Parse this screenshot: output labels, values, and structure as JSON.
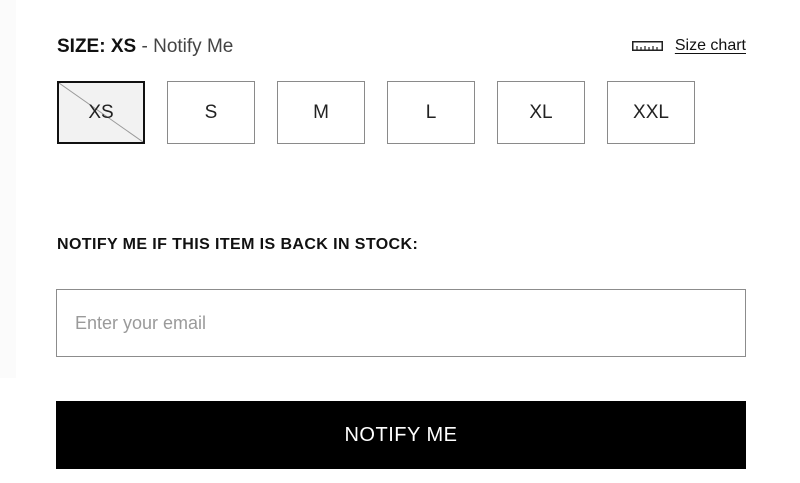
{
  "size_selector": {
    "label": "SIZE:",
    "selected_value": "XS",
    "separator": " - ",
    "status": "Notify Me",
    "size_chart_label": "Size chart",
    "options": [
      {
        "label": "XS",
        "selected": true,
        "unavailable": true
      },
      {
        "label": "S",
        "selected": false,
        "unavailable": false
      },
      {
        "label": "M",
        "selected": false,
        "unavailable": false
      },
      {
        "label": "L",
        "selected": false,
        "unavailable": false
      },
      {
        "label": "XL",
        "selected": false,
        "unavailable": false
      },
      {
        "label": "XXL",
        "selected": false,
        "unavailable": false
      }
    ]
  },
  "notify": {
    "heading": "NOTIFY ME IF THIS ITEM IS BACK IN STOCK:",
    "email_placeholder": "Enter your email",
    "email_value": "",
    "button_label": "NOTIFY ME"
  },
  "icons": {
    "size_chart": "ruler-icon"
  },
  "colors": {
    "button_bg": "#000000",
    "button_text": "#ffffff",
    "selected_border": "#111111",
    "selected_bg": "#f2f2f2",
    "option_border": "#8a8a8a"
  }
}
